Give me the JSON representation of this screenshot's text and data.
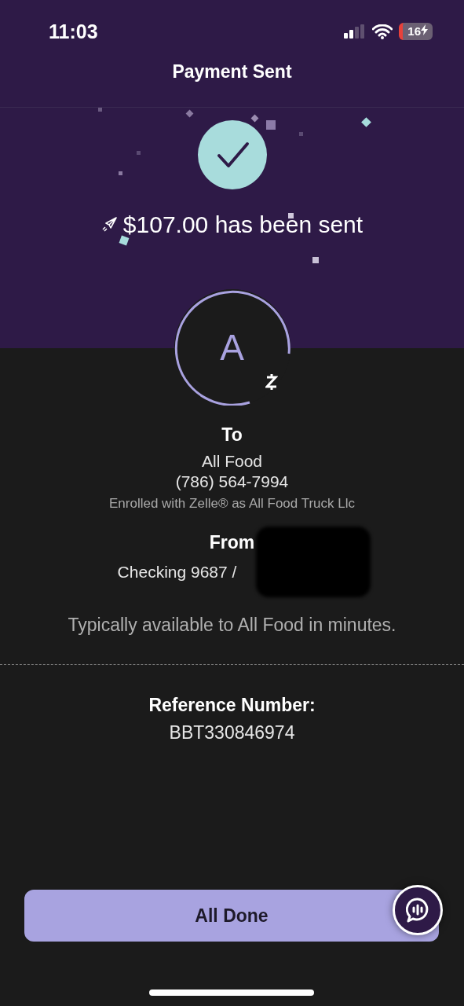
{
  "status_bar": {
    "time": "11:03",
    "battery": "16"
  },
  "header": {
    "title": "Payment Sent"
  },
  "confirmation": {
    "message": "$107.00 has been sent"
  },
  "recipient": {
    "initial": "A",
    "label": "To",
    "name": "All Food",
    "phone": "(786) 564-7994",
    "enrollment": "Enrolled with Zelle® as All Food Truck Llc"
  },
  "sender": {
    "label": "From",
    "account": "Checking 9687 /"
  },
  "availability": "Typically available to All Food in minutes.",
  "reference": {
    "label": "Reference Number:",
    "value": "BBT330846974"
  },
  "buttons": [
    "All Done"
  ]
}
